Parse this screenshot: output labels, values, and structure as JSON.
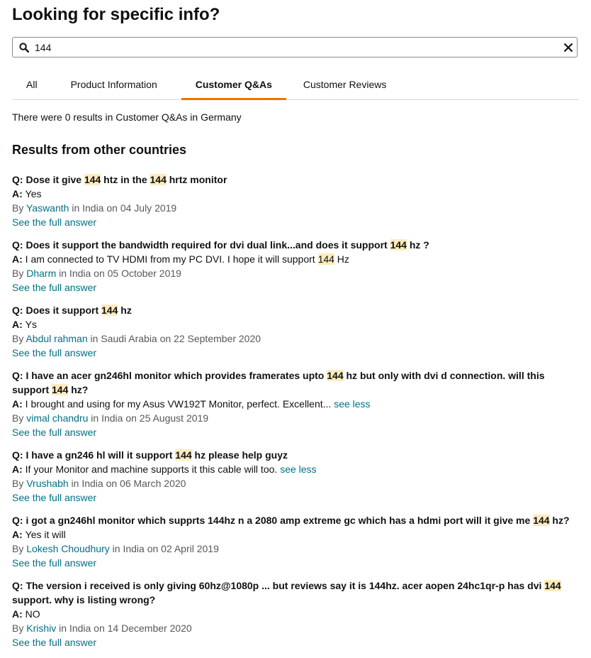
{
  "page_title": "Looking for specific info?",
  "search": {
    "value": "144"
  },
  "tabs": [
    "All",
    "Product Information",
    "Customer Q&As",
    "Customer Reviews"
  ],
  "active_tab": "Customer Q&As",
  "status_text": "There were 0 results in Customer Q&As in Germany",
  "section_title": "Results from other countries",
  "labels": {
    "q": "Q:",
    "a": "A:",
    "by": "By",
    "in": "in",
    "on": "on",
    "see_full": "See the full answer",
    "see_less": "see less"
  },
  "results": [
    {
      "question": [
        [
          "Dose it give ",
          false
        ],
        [
          "144",
          true
        ],
        [
          " htz in the ",
          false
        ],
        [
          "144",
          true
        ],
        [
          " hrtz monitor",
          false
        ]
      ],
      "answer": [
        [
          "Yes",
          false
        ]
      ],
      "see_less": false,
      "author": "Yaswanth",
      "country": "India",
      "date": "04 July 2019"
    },
    {
      "question": [
        [
          "Does it support the bandwidth required for dvi dual link...and does it support ",
          false
        ],
        [
          "144",
          true
        ],
        [
          " hz ?",
          false
        ]
      ],
      "answer": [
        [
          "I am connected to TV HDMI from my PC DVI. I hope it will support ",
          false
        ],
        [
          "144",
          true
        ],
        [
          " Hz",
          false
        ]
      ],
      "see_less": false,
      "author": "Dharm",
      "country": "India",
      "date": "05 October 2019"
    },
    {
      "question": [
        [
          "Does it support ",
          false
        ],
        [
          "144",
          true
        ],
        [
          " hz",
          false
        ]
      ],
      "answer": [
        [
          "Ys",
          false
        ]
      ],
      "see_less": false,
      "author": "Abdul rahman",
      "country": "Saudi Arabia",
      "date": "22 September 2020"
    },
    {
      "question": [
        [
          "I have an acer gn246hl monitor which provides framerates upto ",
          false
        ],
        [
          "144",
          true
        ],
        [
          " hz but only with dvi d connection. will this support ",
          false
        ],
        [
          "144",
          true
        ],
        [
          " hz?",
          false
        ]
      ],
      "answer": [
        [
          "I brought and using for my Asus VW192T Monitor, perfect. Excellent...",
          false
        ]
      ],
      "see_less": true,
      "author": "vimal chandru",
      "country": "India",
      "date": "25 August 2019"
    },
    {
      "question": [
        [
          "I have a gn246 hl will it support ",
          false
        ],
        [
          "144",
          true
        ],
        [
          " hz please help guyz",
          false
        ]
      ],
      "answer": [
        [
          "If your Monitor and machine supports it this cable will too.",
          false
        ]
      ],
      "see_less": true,
      "author": "Vrushabh",
      "country": "India",
      "date": "06 March 2020"
    },
    {
      "question": [
        [
          "i got a gn246hl monitor which supprts 144hz n a 2080 amp extreme gc which has a hdmi port will it give me ",
          false
        ],
        [
          "144",
          true
        ],
        [
          " hz?",
          false
        ]
      ],
      "answer": [
        [
          "Yes it will",
          false
        ]
      ],
      "see_less": false,
      "author": "Lokesh Choudhury",
      "country": "India",
      "date": "02 April 2019"
    },
    {
      "question": [
        [
          "The version i received is only giving 60hz@1080p ... but reviews say it is 144hz. acer aopen 24hc1qr-p has dvi ",
          false
        ],
        [
          "144",
          true
        ],
        [
          " support. why is listing wrong?",
          false
        ]
      ],
      "answer": [
        [
          "NO",
          false
        ]
      ],
      "see_less": false,
      "author": "Krishiv",
      "country": "India",
      "date": "14 December 2020"
    }
  ]
}
